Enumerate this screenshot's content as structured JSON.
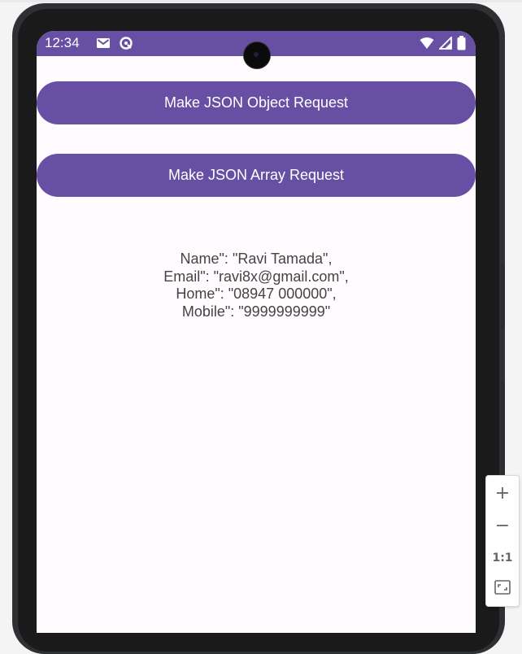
{
  "status_bar": {
    "time": "12:34",
    "left_icons": [
      "mail-icon",
      "sync-icon"
    ],
    "right_icons": [
      "wifi-icon",
      "signal-icon",
      "battery-icon"
    ],
    "color": "#6750a4"
  },
  "buttons": {
    "object_request": "Make JSON Object Request",
    "array_request": "Make JSON Array Request",
    "color": "#6750a4"
  },
  "response_lines": [
    "Name\": \"Ravi Tamada\",",
    "Email\": \"ravi8x@gmail.com\",",
    "Home\": \"08947 000000\",",
    "Mobile\": \"9999999999\""
  ],
  "zoom_controls": {
    "zoom_in": "+",
    "zoom_out": "−",
    "actual_size": "1:1",
    "fit_icon": "fit-screen-icon"
  }
}
